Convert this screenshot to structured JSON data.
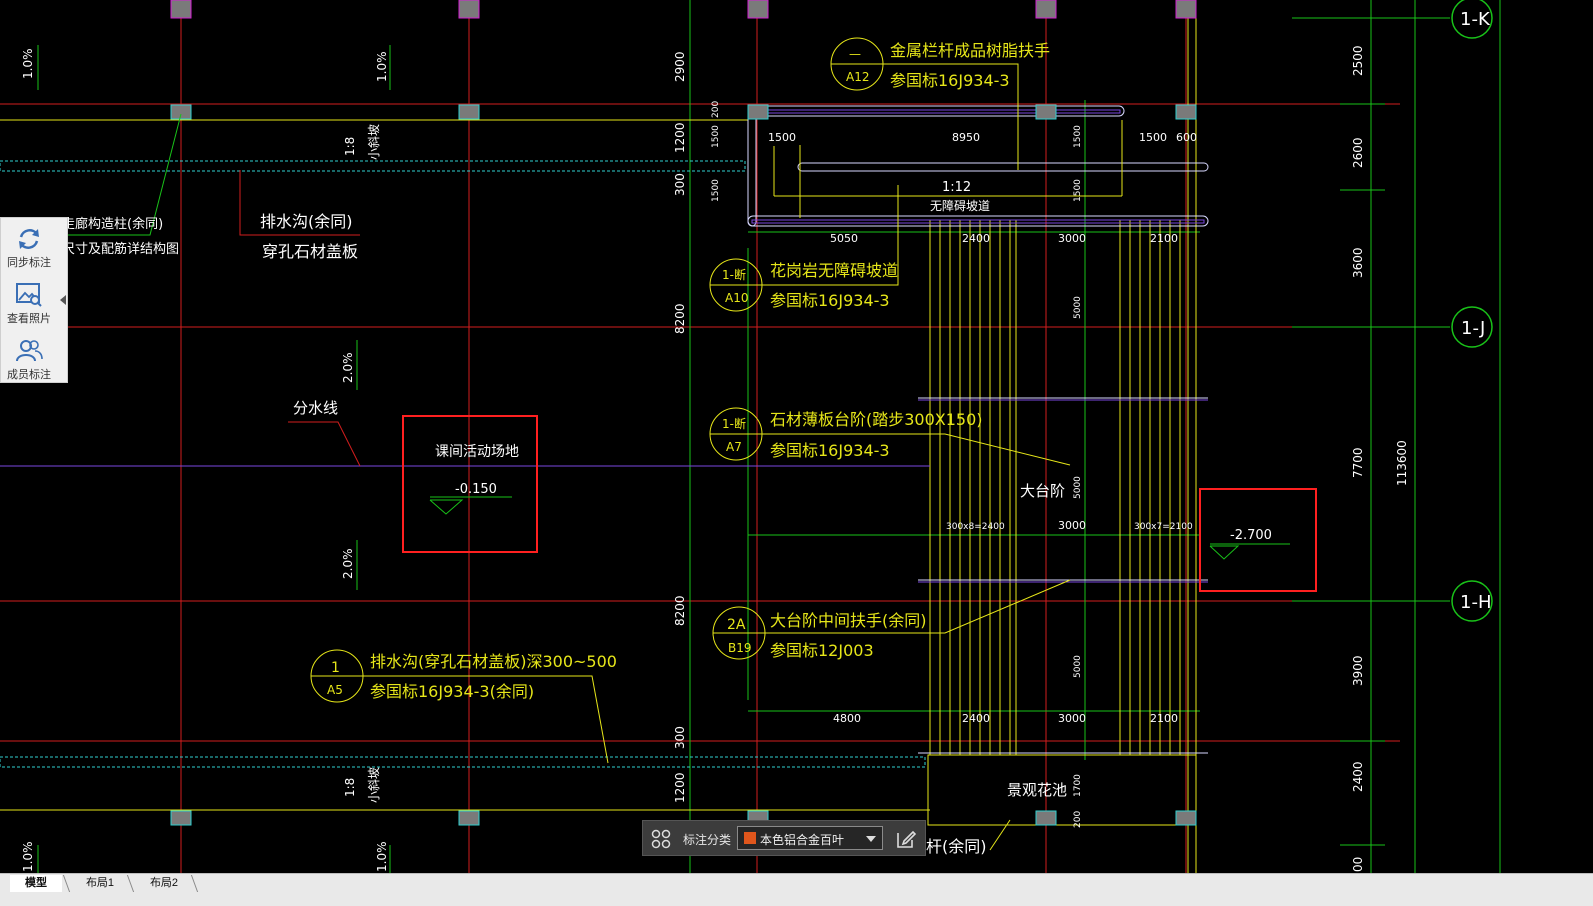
{
  "side_panel": {
    "items": [
      {
        "label": "同步标注",
        "icon": "sync-icon"
      },
      {
        "label": "查看照片",
        "icon": "photo-search-icon"
      },
      {
        "label": "成员标注",
        "icon": "members-icon"
      }
    ],
    "collapse_icon": "collapse-left-icon"
  },
  "toolbar": {
    "grid_icon": "grid-icon",
    "label": "标注分类",
    "selected": "本色铝合金百叶",
    "swatch_color": "#e0561c",
    "edit_icon": "edit-icon"
  },
  "tabs": [
    "模型",
    "布局1",
    "布局2"
  ],
  "drawing": {
    "axis_labels": [
      "1-K",
      "1-J",
      "1-H"
    ],
    "dims_right": [
      "2500",
      "2600",
      "3600",
      "7700",
      "3900",
      "2400",
      "00"
    ],
    "dim_total": "113600",
    "dims_left": [
      "2900",
      "1200",
      "300",
      "8200",
      "8200",
      "300",
      "1200"
    ],
    "slopes_top": [
      "1.0%",
      "1.0%"
    ],
    "slope_mid_1": "2.0%",
    "slope_mid_2": "2.0%",
    "slope_bottom": [
      "1.0%",
      "1.0%"
    ],
    "slope_small_top": "1:8",
    "slope_small_top_text": "小斜坡",
    "slope_small_bottom": "1:8",
    "slope_small_bottom_text": "小斜坡",
    "ramp_dims_v": [
      "200",
      "1500",
      "1500",
      "1500",
      "1500"
    ],
    "ramp_dims_h": [
      "1500",
      "8950",
      "1500",
      "600"
    ],
    "ramp_ratio": "1:12",
    "ramp_label": "无障碍坡道",
    "stair_dims_top": [
      "5050",
      "2400",
      "3000",
      "2100"
    ],
    "stair_dims_v": [
      "5000",
      "5000",
      "5000",
      "1700",
      "200"
    ],
    "stair_dims_mid": [
      "300x8=2400",
      "3000",
      "300x7=2100"
    ],
    "stair_dims_bottom": [
      "4800",
      "2400",
      "3000",
      "2100"
    ],
    "stair_label": "大台阶",
    "planter_label": "景观花池",
    "playground_label": "课间活动场地",
    "playground_level": "-0.150",
    "right_level": "-2.700",
    "divide_line": "分水线",
    "drain_label": "排水沟(余同)",
    "drain_sub": "穿孔石材盖板",
    "corridor_1": "走廊构造柱(余同)",
    "corridor_2": "尺寸及配筋详结构图",
    "callouts": [
      {
        "top": "—",
        "bottom": "A12",
        "line1": "金属栏杆成品树脂扶手",
        "line2": "参国标16J934-3"
      },
      {
        "top": "1-断",
        "bottom": "A10",
        "line1": "花岗岩无障碍坡道",
        "line2": "参国标16J934-3"
      },
      {
        "top": "1-断",
        "bottom": "A7",
        "line1": "石材薄板台阶(踏步300X150)",
        "line2": "参国标16J934-3"
      },
      {
        "top": "2A",
        "bottom": "B19",
        "line1": "大台阶中间扶手(余同)",
        "line2": "参国标12J003"
      },
      {
        "top": "1",
        "bottom": "A5",
        "line1": "排水沟(穿孔石材盖板)深300~500",
        "line2": "参国标16J934-3(余同)"
      }
    ],
    "railing_partial": "杆(余同)",
    "bottom_partial": "1.0%"
  }
}
